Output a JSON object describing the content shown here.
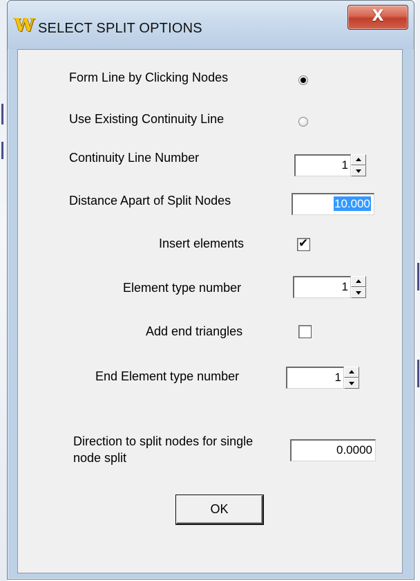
{
  "window": {
    "title": "SELECT SPLIT OPTIONS",
    "app_icon_glyph": "W",
    "close_glyph": "X"
  },
  "options": {
    "form_line_label": "Form Line by Clicking Nodes",
    "form_line_selected": true,
    "existing_line_label": "Use Existing Continuity Line",
    "existing_line_selected": false,
    "continuity_number_label": "Continuity Line Number",
    "continuity_number_value": "1",
    "distance_label": "Distance Apart of Split Nodes",
    "distance_value": "10.000",
    "insert_elements_label": "Insert elements",
    "insert_elements_checked": true,
    "element_type_label": "Element type number",
    "element_type_value": "1",
    "end_triangles_label": "Add end triangles",
    "end_triangles_checked": false,
    "end_element_type_label": "End Element type number",
    "end_element_type_value": "1",
    "direction_label": "Direction to split nodes for single node split",
    "direction_value": "0.0000",
    "ok_label": "OK"
  },
  "icons": {
    "check_glyph": "✔"
  },
  "colors": {
    "selection_bg": "#3399ff",
    "close_button_red": "#c13f2b",
    "dialog_face": "#f0f0f0",
    "title_bar": "#c9daec"
  }
}
